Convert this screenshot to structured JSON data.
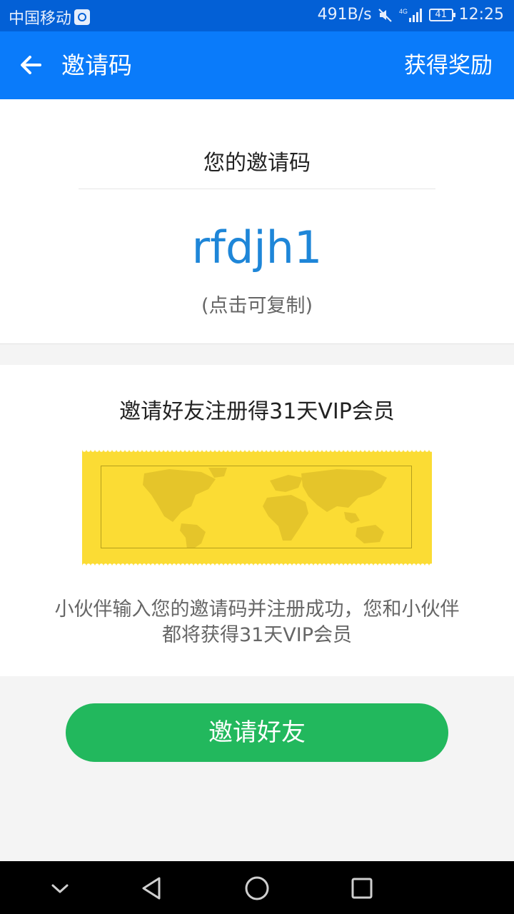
{
  "status_bar": {
    "carrier": "中国移动",
    "speed": "491B/s",
    "network": "4G",
    "battery": "41",
    "time": "12:25"
  },
  "app_bar": {
    "title": "邀请码",
    "action": "获得奖励"
  },
  "code_section": {
    "heading": "您的邀请码",
    "code": "rfdjh1",
    "hint": "(点击可复制)"
  },
  "invite_section": {
    "heading": "邀请好友注册得31天VIP会员",
    "description_line1": "小伙伴输入您的邀请码并注册成功，您和小伙伴",
    "description_line2": "都将获得31天VIP会员"
  },
  "invite_button": {
    "label": "邀请好友"
  },
  "colors": {
    "status_bar": "#0360d6",
    "app_bar": "#0a7bfa",
    "code_text": "#1e86d8",
    "ticket": "#fbdc34",
    "button": "#22b85d"
  },
  "icons": {
    "back": "back-arrow-icon",
    "nav_hide": "chevron-down-icon",
    "nav_back": "triangle-back-icon",
    "nav_home": "circle-home-icon",
    "nav_recents": "square-recents-icon"
  }
}
